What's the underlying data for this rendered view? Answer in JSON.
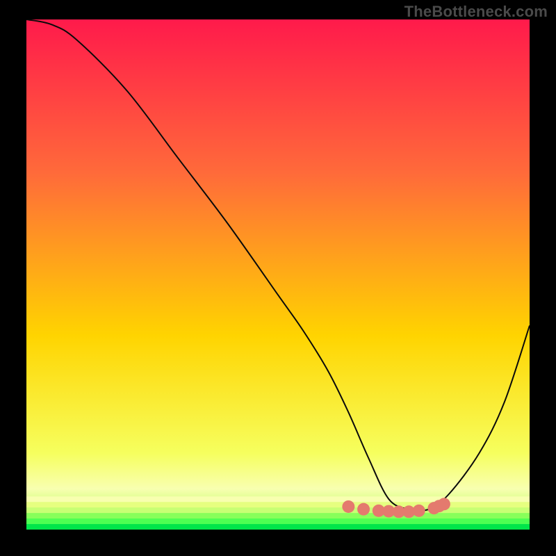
{
  "watermark": "TheBottleneck.com",
  "chart_data": {
    "type": "line",
    "title": "",
    "xlabel": "",
    "ylabel": "",
    "xlim": [
      0,
      100
    ],
    "ylim": [
      0,
      100
    ],
    "grid": false,
    "series": [
      {
        "name": "curve",
        "x": [
          0,
          5,
          10,
          20,
          30,
          40,
          50,
          55,
          60,
          64,
          68,
          72,
          76,
          80,
          84,
          90,
          95,
          100
        ],
        "values": [
          100,
          99,
          96,
          86,
          73,
          60,
          46,
          39,
          31,
          23,
          14,
          6,
          4,
          4,
          7,
          15,
          25,
          40
        ]
      },
      {
        "name": "markers",
        "x": [
          64,
          67,
          70,
          72,
          74,
          76,
          78,
          81,
          82,
          83
        ],
        "values": [
          4.5,
          4.0,
          3.7,
          3.6,
          3.5,
          3.5,
          3.7,
          4.2,
          4.6,
          5.0
        ]
      }
    ],
    "gradient": {
      "top": "#ff1a4b",
      "mid_upper": "#ff6a3a",
      "mid": "#ffd400",
      "mid_lower": "#f6ff5e",
      "band1": "#f8ffb0",
      "band2": "#c8ff74",
      "bottom": "#00e54a"
    },
    "curve_color": "#0a0a0a",
    "marker_color": "#e47a6e",
    "marker_radius": 9,
    "sweet_band_ymax": 6.5
  }
}
